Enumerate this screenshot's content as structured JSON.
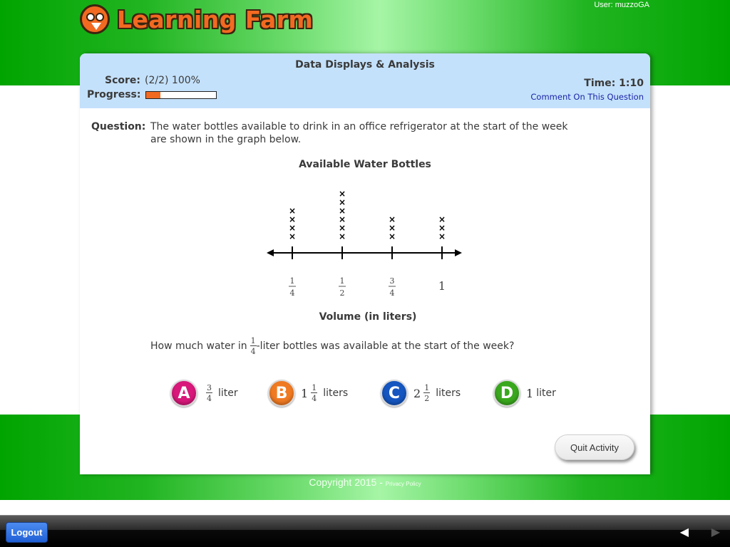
{
  "header": {
    "brand": "Learning Farm",
    "user_label": "User: muzzoGA"
  },
  "panel": {
    "title": "Data Displays & Analysis",
    "score_label": "Score:",
    "score_value": "(2/2) 100%",
    "progress_label": "Progress:",
    "progress_fraction": 0.2,
    "progress_color": "#f26a21",
    "time": "Time: 1:10",
    "comment_link": "Comment On This Question"
  },
  "question": {
    "label": "Question:",
    "text": "The water bottles available to drink in an office refrigerator at the start of the week are shown in the graph below.",
    "prompt_before": "How much water in",
    "prompt_frac_num": "1",
    "prompt_frac_den": "4",
    "prompt_after": "-liter bottles was available at the start of the week?"
  },
  "chart_data": {
    "type": "scatter",
    "subtype": "line-plot",
    "title": "Available Water Bottles",
    "xlabel": "Volume (in liters)",
    "ylabel": "",
    "marker": "x",
    "categories": [
      {
        "num": "1",
        "den": "4",
        "value": 0.25
      },
      {
        "num": "1",
        "den": "2",
        "value": 0.5
      },
      {
        "num": "3",
        "den": "4",
        "value": 0.75
      },
      {
        "num": "1",
        "den": "",
        "value": 1
      }
    ],
    "counts": [
      4,
      6,
      3,
      3
    ],
    "grid": false
  },
  "answers": [
    {
      "letter": "A",
      "color": "#d8187a",
      "whole": "",
      "num": "3",
      "den": "4",
      "unit": "liter"
    },
    {
      "letter": "B",
      "color": "#f07a22",
      "whole": "1",
      "num": "1",
      "den": "4",
      "unit": "liters"
    },
    {
      "letter": "C",
      "color": "#1556c0",
      "whole": "2",
      "num": "1",
      "den": "2",
      "unit": "liters"
    },
    {
      "letter": "D",
      "color": "#3aa81e",
      "whole": "1",
      "num": "",
      "den": "",
      "unit": "liter"
    }
  ],
  "quit_button": "Quit Activity",
  "footer": {
    "copyright": "Copyright 2015 -",
    "privacy": "Privacy Policy"
  },
  "toolbar": {
    "logout": "Logout",
    "prev_icon": "◀",
    "next_icon": "▶"
  }
}
